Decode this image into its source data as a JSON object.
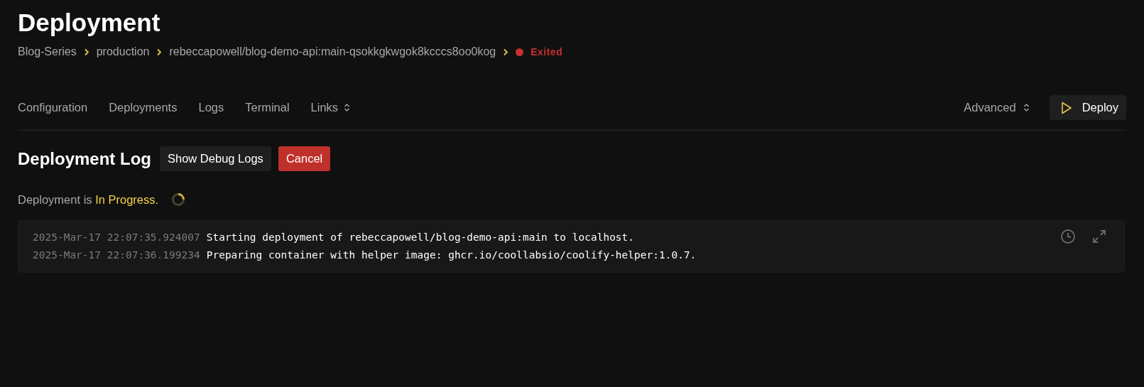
{
  "title": "Deployment",
  "breadcrumbs": [
    "Blog-Series",
    "production",
    "rebeccapowell/blog-demo-api:main-qsokkgkwgok8kcccs8oo0kog"
  ],
  "status": {
    "label": "Exited",
    "color": "#c53030"
  },
  "tabs": [
    {
      "label": "Configuration",
      "selected": false
    },
    {
      "label": "Deployments",
      "selected": false
    },
    {
      "label": "Logs",
      "selected": false
    },
    {
      "label": "Terminal",
      "selected": false
    },
    {
      "label": "Links",
      "selected": false,
      "kind": "dropdown"
    }
  ],
  "advanced": {
    "label": "Advanced"
  },
  "deploy_button": {
    "label": "Deploy"
  },
  "section": {
    "title": "Deployment Log",
    "buttons": [
      {
        "label": "Show Debug Logs",
        "kind": "default"
      },
      {
        "label": "Cancel",
        "kind": "danger"
      }
    ]
  },
  "progress": {
    "prefix": "Deployment is",
    "state": "In Progress."
  },
  "log_lines": [
    {
      "time": "2025-Mar-17 22:07:35.924007",
      "message": "Starting deployment of rebeccapowell/blog-demo-api:main to localhost."
    },
    {
      "time": "2025-Mar-17 22:07:36.199234",
      "message": "Preparing container with helper image: ghcr.io/coollabsio/coolify-helper:1.0.7."
    }
  ]
}
